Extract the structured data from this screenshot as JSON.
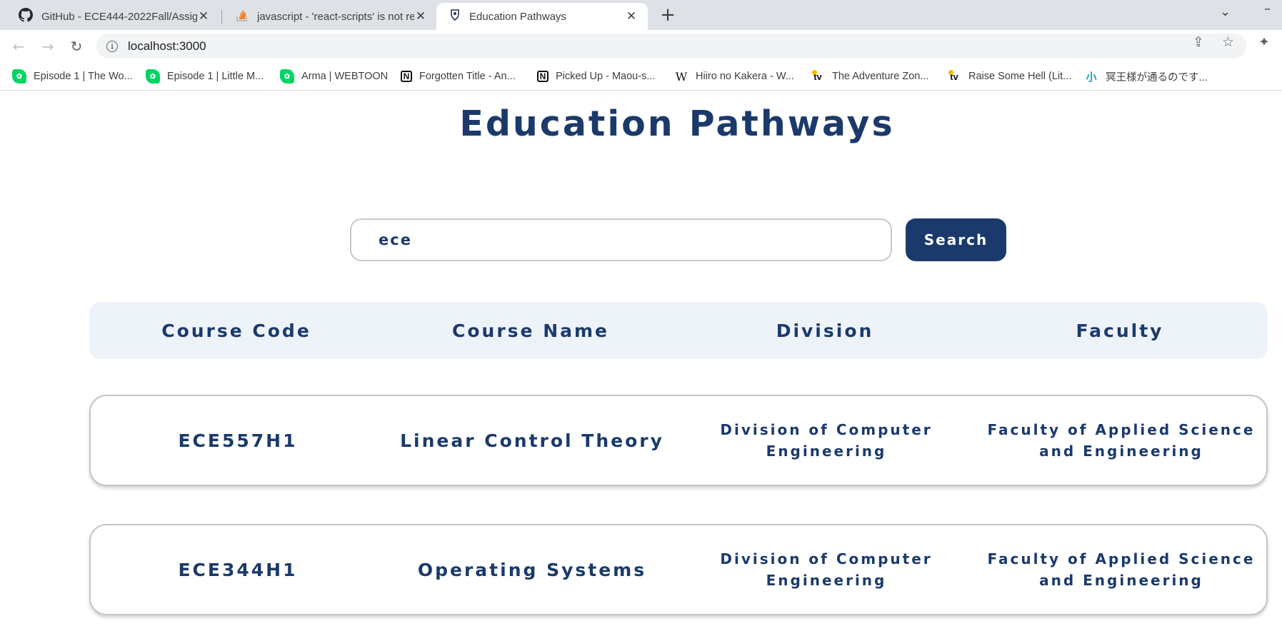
{
  "browser": {
    "tabs": [
      {
        "title": "GitHub - ECE444-2022Fall/Assignment",
        "favicon": "github-icon",
        "active": false
      },
      {
        "title": "javascript - 'react-scripts' is not re",
        "favicon": "stackoverflow-icon",
        "active": false
      },
      {
        "title": "Education Pathways",
        "favicon": "uoft-crest-icon",
        "active": true
      }
    ],
    "new_tab_label": "+",
    "address": "localhost:3000",
    "bookmarks": [
      {
        "label": "Episode 1 | The Wo...",
        "icon": "webtoon-icon"
      },
      {
        "label": "Episode 1 | Little M...",
        "icon": "webtoon-icon"
      },
      {
        "label": "Arma | WEBTOON",
        "icon": "webtoon-icon"
      },
      {
        "label": "Forgotten Title - An...",
        "icon": "notion-icon"
      },
      {
        "label": "Picked Up - Maou-s...",
        "icon": "notion-icon"
      },
      {
        "label": "Hiiro no Kakera - W...",
        "icon": "wikipedia-icon"
      },
      {
        "label": "The Adventure Zon...",
        "icon": "tv-icon"
      },
      {
        "label": "Raise Some Hell (Lit...",
        "icon": "tv-icon"
      },
      {
        "label": "冥王様が通るのです...",
        "icon": "syosetu-icon"
      }
    ]
  },
  "page": {
    "title": "Education Pathways",
    "search": {
      "value": "ece",
      "button_label": "Search"
    },
    "table": {
      "headers": [
        "Course Code",
        "Course Name",
        "Division",
        "Faculty"
      ],
      "rows": [
        {
          "code": "ECE557H1",
          "name": "Linear Control Theory",
          "division": "Division of Computer Engineering",
          "faculty": "Faculty of Applied Science and Engineering"
        },
        {
          "code": "ECE344H1",
          "name": "Operating Systems",
          "division": "Division of Computer Engineering",
          "faculty": "Faculty of Applied Science and Engineering"
        }
      ]
    }
  },
  "colors": {
    "brand_navy": "#1b3a6b",
    "header_bg": "#eef3fa"
  }
}
